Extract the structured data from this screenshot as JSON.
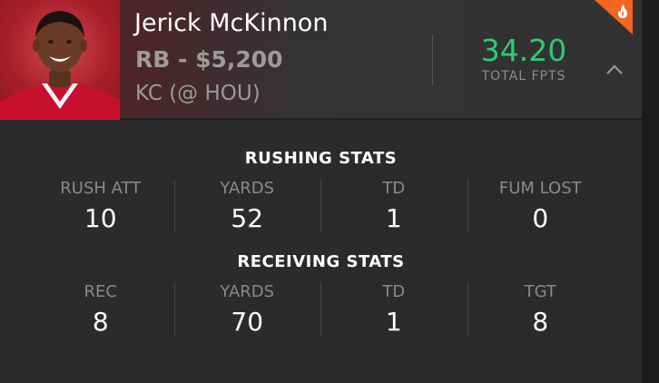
{
  "player": {
    "name": "Jerick McKinnon",
    "position_salary": "RB - $5,200",
    "matchup": "KC (@ HOU)",
    "fpts_value": "34.20",
    "fpts_label": "TOTAL FPTS"
  },
  "icons": {
    "hot": "fire-icon",
    "collapse": "chevron-up-icon",
    "accent_color": "#f26522"
  },
  "rushing": {
    "title": "RUSHING STATS",
    "stats": [
      {
        "label": "RUSH ATT",
        "value": "10"
      },
      {
        "label": "YARDS",
        "value": "52"
      },
      {
        "label": "TD",
        "value": "1"
      },
      {
        "label": "FUM LOST",
        "value": "0"
      }
    ]
  },
  "receiving": {
    "title": "RECEIVING STATS",
    "stats": [
      {
        "label": "REC",
        "value": "8"
      },
      {
        "label": "YARDS",
        "value": "70"
      },
      {
        "label": "TD",
        "value": "1"
      },
      {
        "label": "TGT",
        "value": "8"
      }
    ]
  }
}
